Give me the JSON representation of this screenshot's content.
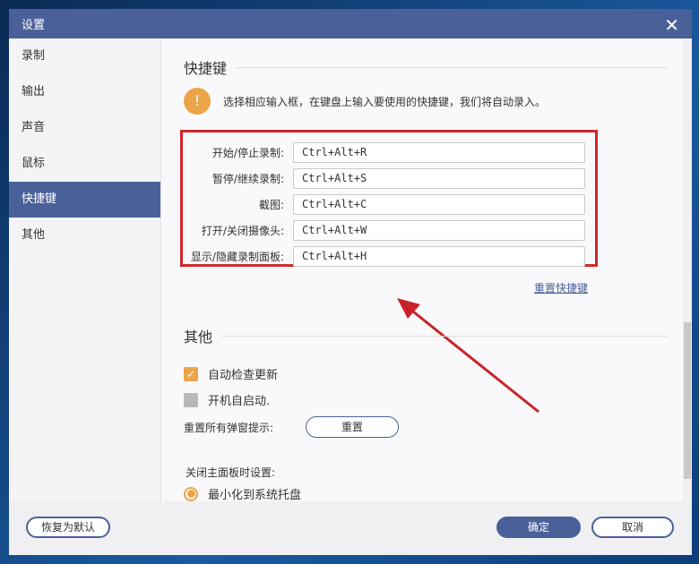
{
  "window": {
    "title": "设置"
  },
  "sidebar": {
    "items": [
      {
        "label": "录制"
      },
      {
        "label": "输出"
      },
      {
        "label": "声音"
      },
      {
        "label": "鼠标"
      },
      {
        "label": "快捷键"
      },
      {
        "label": "其他"
      }
    ]
  },
  "hotkeys": {
    "title": "快捷键",
    "tip": "选择相应输入框，在键盘上输入要使用的快捷键，我们将自动录入。",
    "rows": [
      {
        "label": "开始/停止录制:",
        "value": "Ctrl+Alt+R"
      },
      {
        "label": "暂停/继续录制:",
        "value": "Ctrl+Alt+S"
      },
      {
        "label": "截图:",
        "value": "Ctrl+Alt+C"
      },
      {
        "label": "打开/关闭摄像头:",
        "value": "Ctrl+Alt+W"
      },
      {
        "label": "显示/隐藏录制面板:",
        "value": "Ctrl+Alt+H"
      }
    ],
    "reset_link": "重置快捷键"
  },
  "other": {
    "title": "其他",
    "auto_update": "自动检查更新",
    "auto_update_checked": true,
    "autostart": "开机自启动.",
    "autostart_checked": false,
    "reset_popups_label": "重置所有弹窗提示:",
    "reset_button": "重置",
    "close_panel_label": "关闭主面板时设置:",
    "minimize_option": "最小化到系统托盘"
  },
  "footer": {
    "restore": "恢复为默认",
    "ok": "确定",
    "cancel": "取消"
  }
}
